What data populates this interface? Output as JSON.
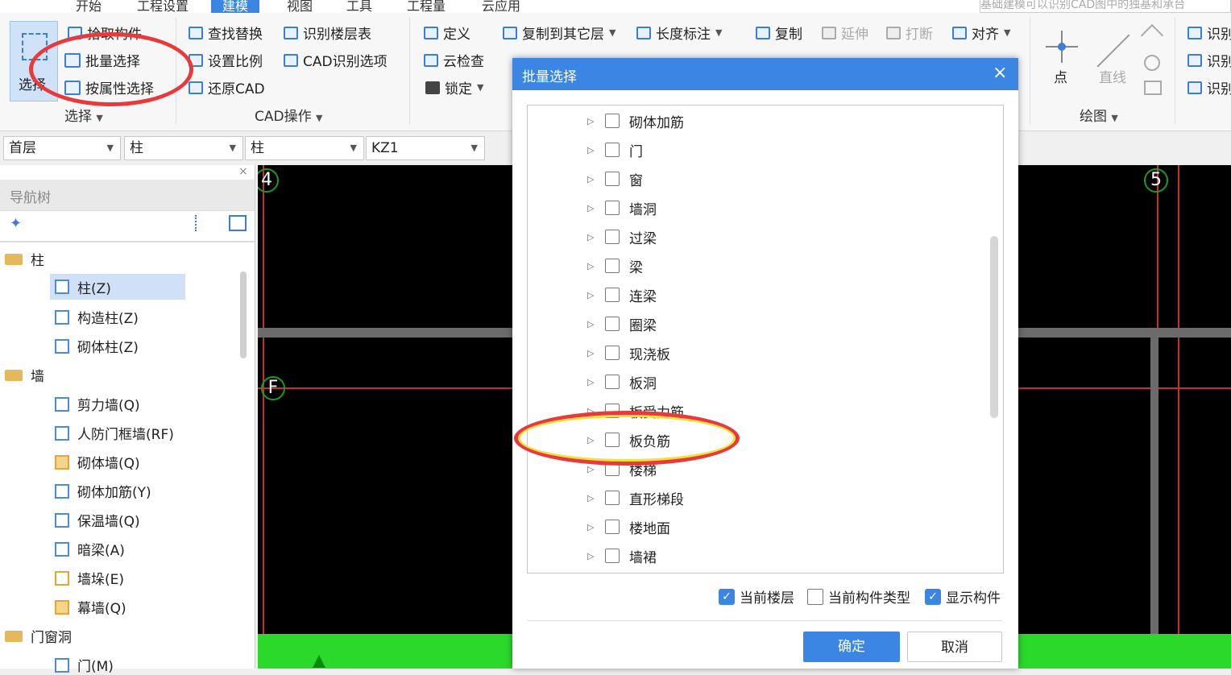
{
  "menu": {
    "tabs": [
      "开始",
      "工程设置",
      "建模",
      "视图",
      "工具",
      "工程量",
      "云应用"
    ],
    "active_index": 2,
    "hint": "基础建模可以识别CAD图中的独基和承台"
  },
  "ribbon": {
    "select_group": {
      "big_button": "选择",
      "pick": "拾取构件",
      "batch": "批量选择",
      "by_attr": "按属性选择",
      "group_label": "选择"
    },
    "cad_group": {
      "find_replace": "查找替换",
      "set_scale": "设置比例",
      "restore_cad": "还原CAD",
      "identify_floor": "识别楼层表",
      "cad_options": "CAD识别选项",
      "group_label": "CAD操作"
    },
    "edit_group": {
      "define": "定义",
      "cloud_check": "云检查",
      "lock": "锁定",
      "copy_to_floor": "复制到其它层",
      "length_mark": "长度标注",
      "copy": "复制",
      "extend": "延伸",
      "break": "打断",
      "align": "对齐"
    },
    "draw_group": {
      "point": "点",
      "line": "直线",
      "group_label": "绘图"
    },
    "identify_group": {
      "label": "识别"
    }
  },
  "dropdowns": [
    {
      "value": "首层"
    },
    {
      "value": "柱"
    },
    {
      "value": "柱"
    },
    {
      "value": "KZ1"
    }
  ],
  "nav": {
    "title": "导航树",
    "items": [
      {
        "label": "柱",
        "type": "folder"
      },
      {
        "label": "柱(Z)",
        "type": "item",
        "selected": true
      },
      {
        "label": "构造柱(Z)",
        "type": "item"
      },
      {
        "label": "砌体柱(Z)",
        "type": "item"
      },
      {
        "label": "墙",
        "type": "folder"
      },
      {
        "label": "剪力墙(Q)",
        "type": "item"
      },
      {
        "label": "人防门框墙(RF)",
        "type": "item"
      },
      {
        "label": "砌体墙(Q)",
        "type": "item"
      },
      {
        "label": "砌体加筋(Y)",
        "type": "item"
      },
      {
        "label": "保温墙(Q)",
        "type": "item"
      },
      {
        "label": "暗梁(A)",
        "type": "item"
      },
      {
        "label": "墙垛(E)",
        "type": "item"
      },
      {
        "label": "幕墙(Q)",
        "type": "item"
      },
      {
        "label": "门窗洞",
        "type": "folder"
      },
      {
        "label": "门(M)",
        "type": "item"
      }
    ]
  },
  "canvas": {
    "axis_labels": [
      "4",
      "F",
      "5"
    ]
  },
  "dialog": {
    "title": "批量选择",
    "close_glyph": "×",
    "tree": [
      "砌体加筋",
      "门",
      "窗",
      "墙洞",
      "过梁",
      "梁",
      "连梁",
      "圈梁",
      "现浇板",
      "板洞",
      "板受力筋",
      "板负筋",
      "楼梯",
      "直形梯段",
      "楼地面",
      "墙裙"
    ],
    "options": [
      {
        "label": "当前楼层",
        "checked": true
      },
      {
        "label": "当前构件类型",
        "checked": false
      },
      {
        "label": "显示构件",
        "checked": true
      }
    ],
    "ok": "确定",
    "cancel": "取消"
  },
  "colors": {
    "accent": "#3b86e3",
    "highlight_circle": "#e83a3a",
    "cad_red": "#c23030",
    "cad_green": "#2bd92b"
  }
}
